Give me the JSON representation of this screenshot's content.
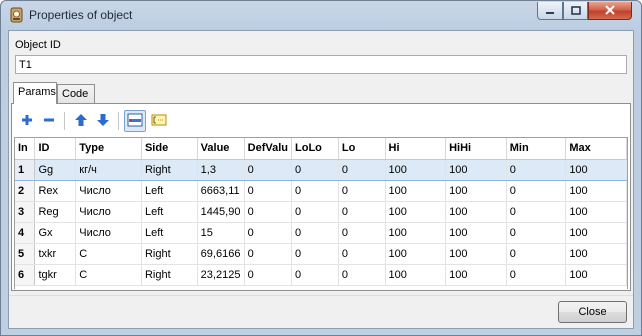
{
  "window": {
    "title": "Properties of object"
  },
  "object_id": {
    "label": "Object ID",
    "value": "T1"
  },
  "tabs": [
    {
      "label": "Params"
    },
    {
      "label": "Code"
    }
  ],
  "colors": {
    "selection": "#dce9f7",
    "add": "#2a6ccf",
    "remove": "#2a6ccf"
  },
  "toolbar": {
    "icons": [
      "add-icon",
      "remove-icon",
      "move-up-icon",
      "move-down-icon",
      "table-view-icon",
      "edit-field-icon"
    ]
  },
  "table": {
    "columns": [
      "In",
      "ID",
      "Type",
      "Side",
      "Value",
      "DefValu",
      "LoLo",
      "Lo",
      "Hi",
      "HiHi",
      "Min",
      "Max"
    ],
    "rows": [
      [
        "1",
        "Gg",
        "кг/ч",
        "Right",
        "1,3",
        "0",
        "0",
        "0",
        "100",
        "100",
        "0",
        "100"
      ],
      [
        "2",
        "Rex",
        "Число",
        "Left",
        "6663,11",
        "0",
        "0",
        "0",
        "100",
        "100",
        "0",
        "100"
      ],
      [
        "3",
        "Reg",
        "Число",
        "Left",
        "1445,90",
        "0",
        "0",
        "0",
        "100",
        "100",
        "0",
        "100"
      ],
      [
        "4",
        "Gx",
        "Число",
        "Left",
        "15",
        "0",
        "0",
        "0",
        "100",
        "100",
        "0",
        "100"
      ],
      [
        "5",
        "txkr",
        "C",
        "Right",
        "69,6166",
        "0",
        "0",
        "0",
        "100",
        "100",
        "0",
        "100"
      ],
      [
        "6",
        "tgkr",
        "C",
        "Right",
        "23,2125",
        "0",
        "0",
        "0",
        "100",
        "100",
        "0",
        "100"
      ]
    ],
    "selected_row": 0
  },
  "buttons": {
    "close_label": "Close"
  }
}
